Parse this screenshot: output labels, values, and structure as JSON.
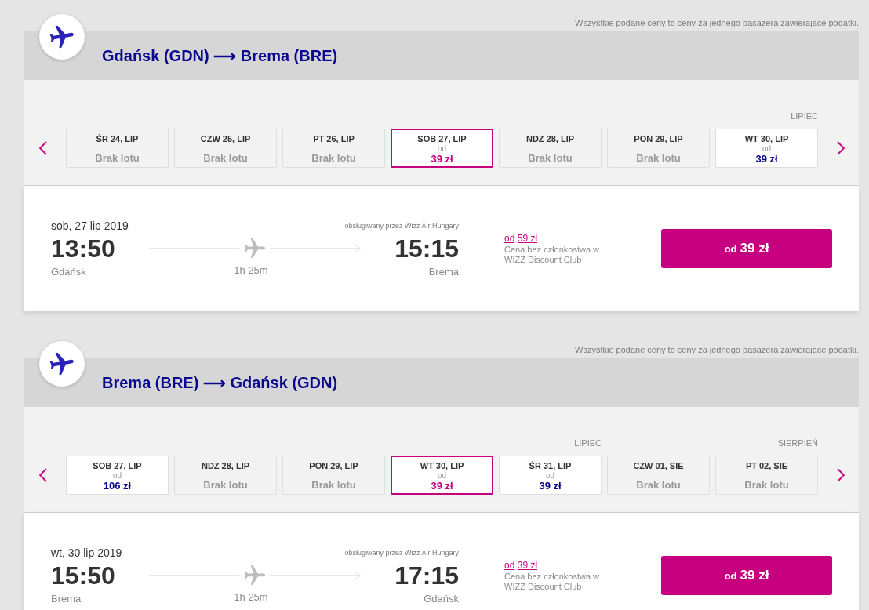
{
  "legs": [
    {
      "price_note": "Wszystkie podane ceny to ceny za jednego pasażera zawierające podatki.",
      "route": "Gdańsk (GDN) ⟶ Brema (BRE)",
      "days": [
        {
          "kind": "no_flight",
          "label": "ŚR 24, LIP",
          "status": "Brak lotu",
          "selected": false
        },
        {
          "kind": "no_flight",
          "label": "CZW 25, LIP",
          "status": "Brak lotu",
          "selected": false
        },
        {
          "kind": "no_flight",
          "label": "PT 26, LIP",
          "status": "Brak lotu",
          "selected": false
        },
        {
          "kind": "fare",
          "label": "SOB 27, LIP",
          "from": "od",
          "price": "39 zł",
          "selected": true
        },
        {
          "kind": "no_flight",
          "label": "NDZ 28, LIP",
          "status": "Brak lotu",
          "selected": false
        },
        {
          "kind": "no_flight",
          "label": "PON 29, LIP",
          "status": "Brak lotu",
          "selected": false
        },
        {
          "kind": "fare",
          "label": "WT 30, LIP",
          "from": "od",
          "price": "39 zł",
          "selected": false,
          "month": "LIPIEC"
        }
      ],
      "flight": {
        "date": "sob, 27 lip 2019",
        "operator": "obsługiwany przez Wizz Air Hungary",
        "departure_time": "13:50",
        "departure_city": "Gdańsk",
        "duration": "1h 25m",
        "arrival_time": "15:15",
        "arrival_city": "Brema",
        "club": {
          "from": "od",
          "price": "59 zł",
          "note": "Cena bez członkostwa w WIZZ Discount Club"
        },
        "fare_button": {
          "from": "od",
          "price": "39 zł"
        }
      }
    },
    {
      "price_note": "Wszystkie podane ceny to ceny za jednego pasażera zawierające podatki.",
      "route": "Brema (BRE) ⟶ Gdańsk (GDN)",
      "days": [
        {
          "kind": "fare",
          "label": "SOB 27, LIP",
          "from": "od",
          "price": "106 zł",
          "selected": false
        },
        {
          "kind": "no_flight",
          "label": "NDZ 28, LIP",
          "status": "Brak lotu",
          "selected": false
        },
        {
          "kind": "no_flight",
          "label": "PON 29, LIP",
          "status": "Brak lotu",
          "selected": false
        },
        {
          "kind": "fare",
          "label": "WT 30, LIP",
          "from": "od",
          "price": "39 zł",
          "selected": true
        },
        {
          "kind": "fare",
          "label": "ŚR 31, LIP",
          "from": "od",
          "price": "39 zł",
          "selected": false,
          "month": "LIPIEC"
        },
        {
          "kind": "no_flight",
          "label": "CZW 01, SIE",
          "status": "Brak lotu",
          "selected": false
        },
        {
          "kind": "no_flight",
          "label": "PT 02, SIE",
          "status": "Brak lotu",
          "selected": false,
          "month": "SIERPIEŃ"
        }
      ],
      "flight": {
        "date": "wt, 30 lip 2019",
        "operator": "obsługiwany przez Wizz Air Hungary",
        "departure_time": "15:50",
        "departure_city": "Brema",
        "duration": "1h 25m",
        "arrival_time": "17:15",
        "arrival_city": "Gdańsk",
        "club": {
          "from": "od",
          "price": "39 zł",
          "note": "Cena bez członkostwa w WIZZ Discount Club"
        },
        "fare_button": {
          "from": "od",
          "price": "39 zł"
        }
      }
    }
  ]
}
